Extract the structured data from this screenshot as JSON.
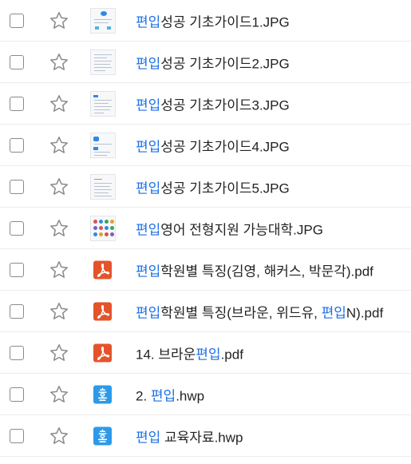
{
  "colors": {
    "highlight": "#1b6fe6",
    "pdf_icon": "#e5532b",
    "hwp_icon": "#2c9ae8",
    "star_outline": "#8a8a8a",
    "row_divider": "#ececec"
  },
  "files": [
    {
      "icon": "image-thumbnail",
      "name_parts": [
        "편입",
        "성공 기초가이드1.JPG",
        "",
        ""
      ]
    },
    {
      "icon": "image-thumbnail",
      "name_parts": [
        "편입",
        "성공 기초가이드2.JPG",
        "",
        ""
      ]
    },
    {
      "icon": "image-thumbnail",
      "name_parts": [
        "편입",
        "성공 기초가이드3.JPG",
        "",
        ""
      ]
    },
    {
      "icon": "image-thumbnail",
      "name_parts": [
        "편입",
        "성공 기초가이드4.JPG",
        "",
        ""
      ]
    },
    {
      "icon": "image-thumbnail",
      "name_parts": [
        "편입",
        "성공 기초가이드5.JPG",
        "",
        ""
      ]
    },
    {
      "icon": "image-thumbnail",
      "name_parts": [
        "편입",
        "영어 전형지원 가능대학.JPG",
        "",
        ""
      ]
    },
    {
      "icon": "pdf-icon",
      "name_parts": [
        "편입",
        "학원별 특징(김영, 해커스, 박문각).pdf",
        "",
        ""
      ]
    },
    {
      "icon": "pdf-icon",
      "name_parts": [
        "편입",
        "학원별 특징(브라운, 위드유, ",
        "편입",
        "N).pdf"
      ]
    },
    {
      "icon": "pdf-icon",
      "name_parts": [
        "",
        "14. 브라운",
        "편입",
        ".pdf"
      ]
    },
    {
      "icon": "hwp-icon",
      "name_parts": [
        "",
        "2. ",
        "편입",
        ".hwp"
      ]
    },
    {
      "icon": "hwp-icon",
      "name_parts": [
        "편입",
        " 교육자료.hwp",
        "",
        ""
      ]
    }
  ]
}
